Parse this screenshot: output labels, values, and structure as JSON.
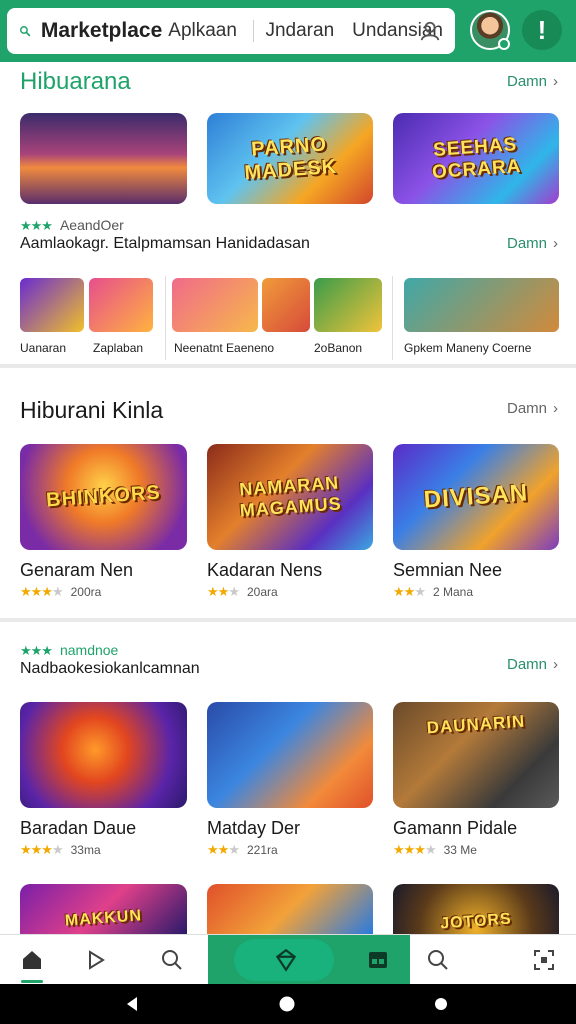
{
  "topbar": {
    "app_title": "Marketplace",
    "search_terms": [
      "Aplkaan",
      "Jndaran",
      "Undansian"
    ],
    "accent": "#1fa36a",
    "alert_glyph": "!"
  },
  "sections": {
    "s1": {
      "title": "Hibuarana",
      "more": "Damn",
      "rating_label": "AeandOer",
      "subtitle": "Aamlaokagr. Etalpmamsan Hanidadasan",
      "sub_more": "Damn",
      "cards": [
        {
          "label": ""
        },
        {
          "label": "PARNO MADESK"
        },
        {
          "label": "SEEHAS OCRARA"
        }
      ],
      "mini_groups": [
        {
          "caption_a": "Uanaran",
          "caption_b": "Zaplaban"
        },
        {
          "caption": "Neenatnt Eaeneno",
          "caption_b": "2oBanon"
        },
        {
          "caption": "Gpkem Maneny Coerne"
        }
      ]
    },
    "s2": {
      "title": "Hiburani Kinla",
      "more": "Damn",
      "cards": [
        {
          "label": "BHINKORS",
          "caption": "Genaram Nen",
          "rating": "200ra",
          "stars": 3
        },
        {
          "label": "NAMARAN MAGAMUS",
          "caption": "Kadaran Nens",
          "rating": "20ara",
          "stars": 2
        },
        {
          "label": "DIVISAN",
          "caption": "Semnian Nee",
          "rating": "2 Mana",
          "stars": 3
        }
      ]
    },
    "s3": {
      "rating_label": "namdnoe",
      "subtitle": "Nadbaokesiokanlcamnan",
      "more": "Damn",
      "cards": [
        {
          "label": "",
          "caption": "Baradan Daue",
          "rating": "33ma",
          "stars": 3
        },
        {
          "label": "",
          "caption": "Matday Der",
          "rating": "221ra",
          "stars": 2
        },
        {
          "label": "DAUNARIN",
          "caption": "Gamann Pidale",
          "rating": "33 Me",
          "stars": 3
        }
      ]
    },
    "s4": {
      "cards": [
        {
          "label": "MAKKUN"
        },
        {
          "label": ""
        },
        {
          "label": "JOTORS"
        }
      ]
    }
  },
  "bottom_nav": [
    "home-icon",
    "play-icon",
    "search-icon",
    "diamond-icon",
    "store-icon",
    "search-icon",
    "scan-icon"
  ],
  "system_nav": [
    "back-icon",
    "home-circle-icon",
    "recents-dot-icon"
  ]
}
